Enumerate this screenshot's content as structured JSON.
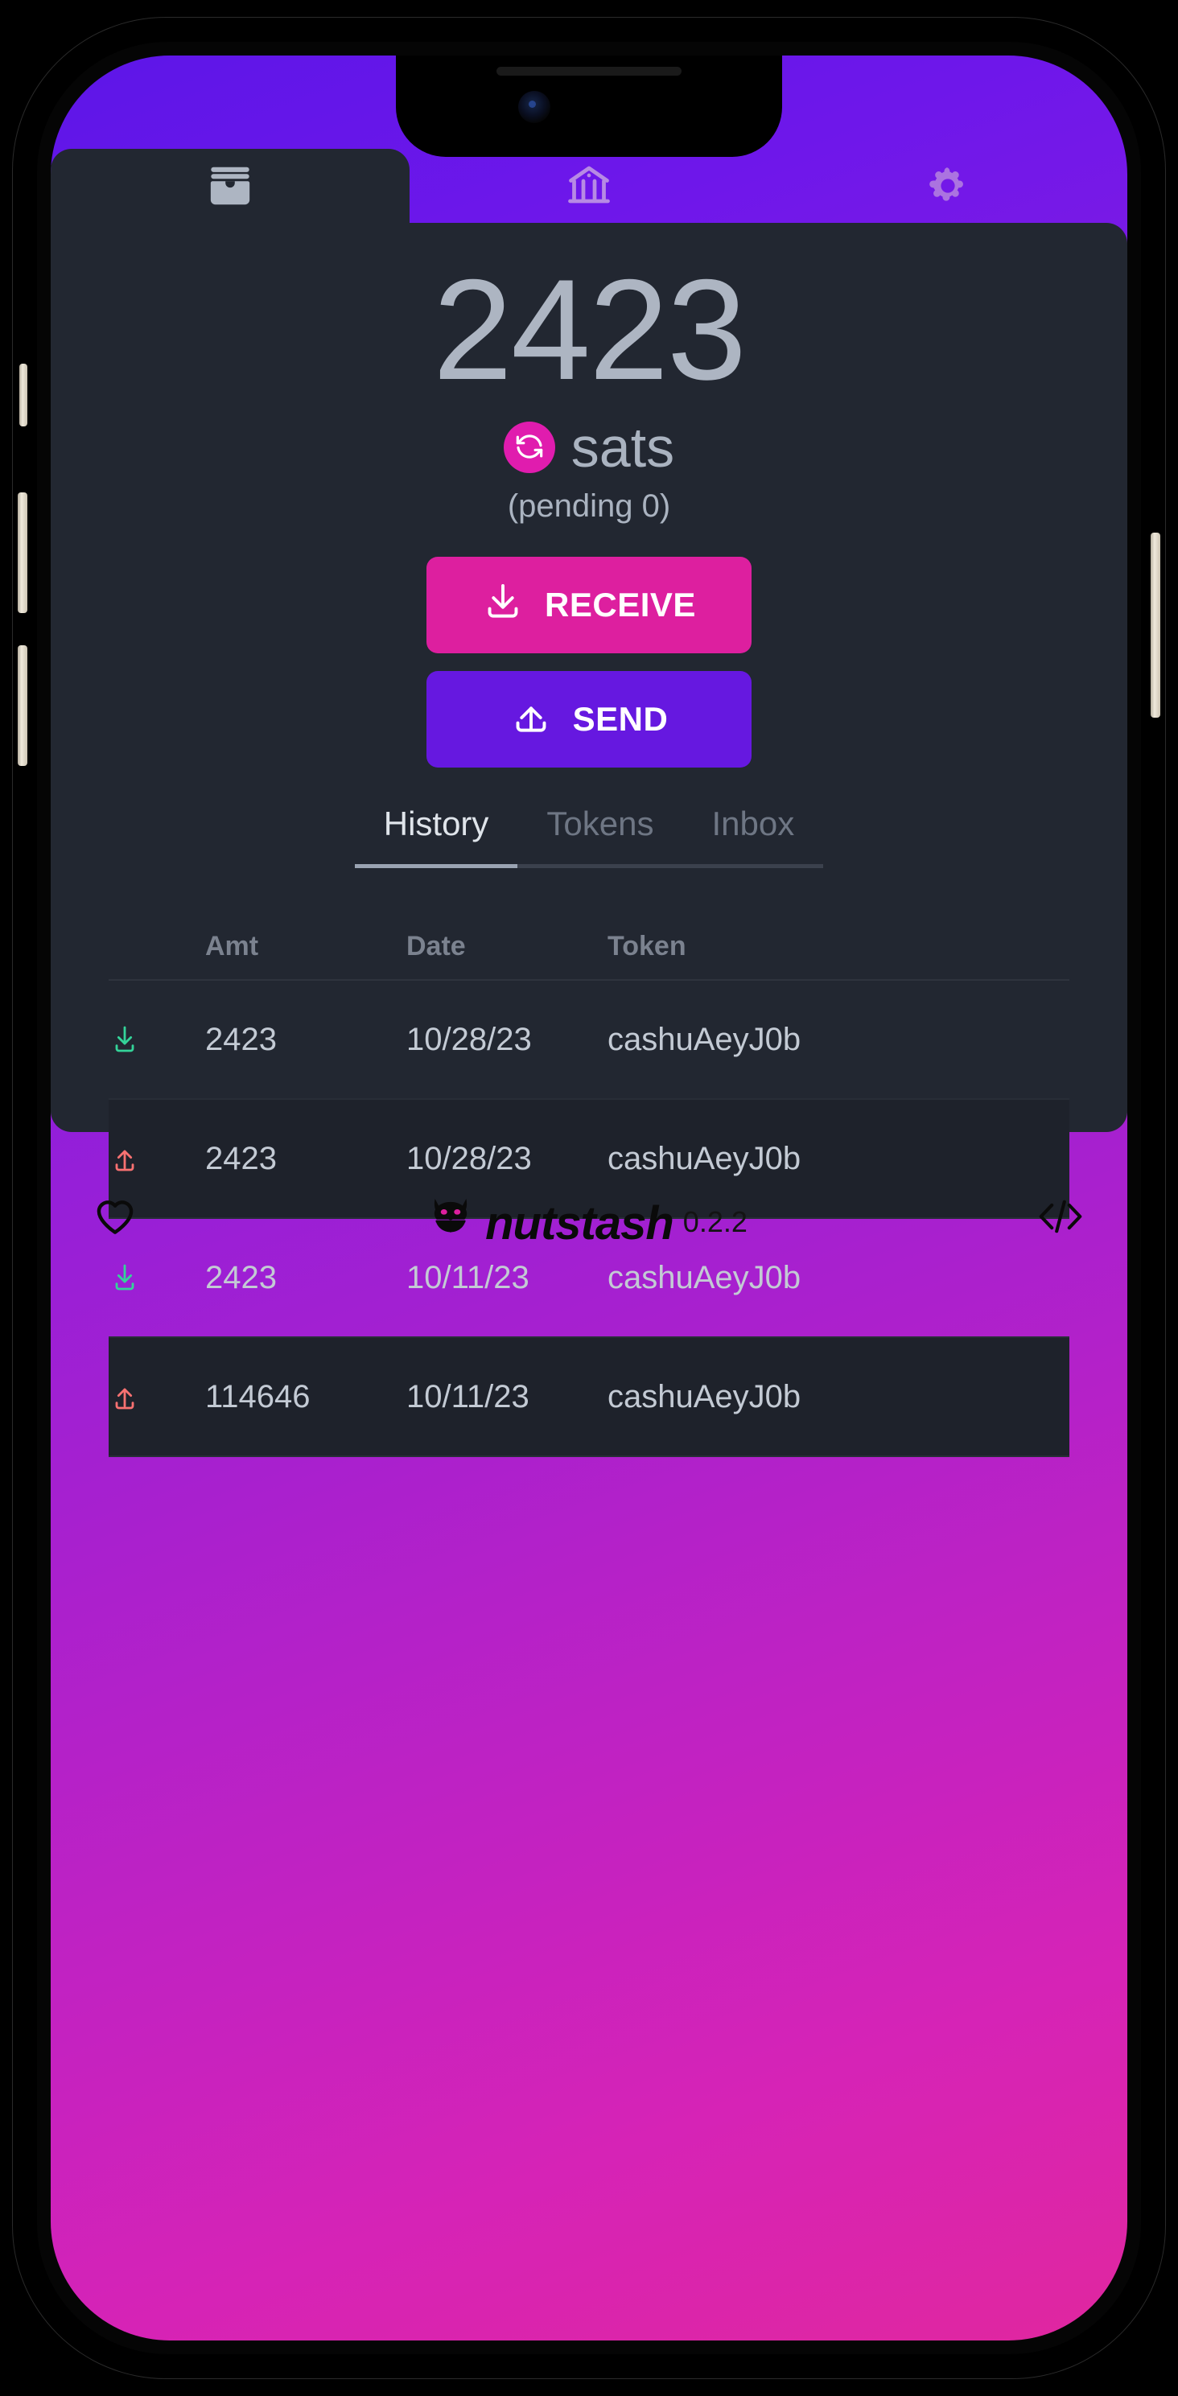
{
  "app": {
    "name": "nutstash",
    "version": "0.2.2"
  },
  "tabs": [
    {
      "id": "wallet",
      "icon": "wallet-icon",
      "active": true
    },
    {
      "id": "mints",
      "icon": "bank-icon",
      "active": false
    },
    {
      "id": "settings",
      "icon": "gear-icon",
      "active": false
    }
  ],
  "wallet": {
    "balance": "2423",
    "unit": "sats",
    "pending": "(pending 0)",
    "sync_icon": "refresh-icon",
    "receive_label": "RECEIVE",
    "receive_icon": "download-icon",
    "send_label": "SEND",
    "send_icon": "upload-icon"
  },
  "subtabs": [
    {
      "label": "History",
      "active": true
    },
    {
      "label": "Tokens",
      "active": false
    },
    {
      "label": "Inbox",
      "active": false
    }
  ],
  "history": {
    "columns": [
      "",
      "Amt",
      "Date",
      "Token"
    ],
    "rows": [
      {
        "direction": "in",
        "amount": "2423",
        "date": "10/28/23",
        "token": "cashuAeyJ0b"
      },
      {
        "direction": "out",
        "amount": "2423",
        "date": "10/28/23",
        "token": "cashuAeyJ0b"
      },
      {
        "direction": "in",
        "amount": "2423",
        "date": "10/11/23",
        "token": "cashuAeyJ0b"
      },
      {
        "direction": "out",
        "amount": "114646",
        "date": "10/11/23",
        "token": "cashuAeyJ0b"
      }
    ]
  },
  "footer": {
    "left_icon": "heart-icon",
    "right_icon": "code-icon",
    "brand_text": "nutstash",
    "version_text": "0.2.2"
  },
  "colors": {
    "accent_pink": "#dd1f9f",
    "accent_purple": "#6618e0",
    "card_bg": "#222731",
    "text_muted": "#aab3c0",
    "in_arrow": "#34d399",
    "out_arrow": "#f87171"
  }
}
